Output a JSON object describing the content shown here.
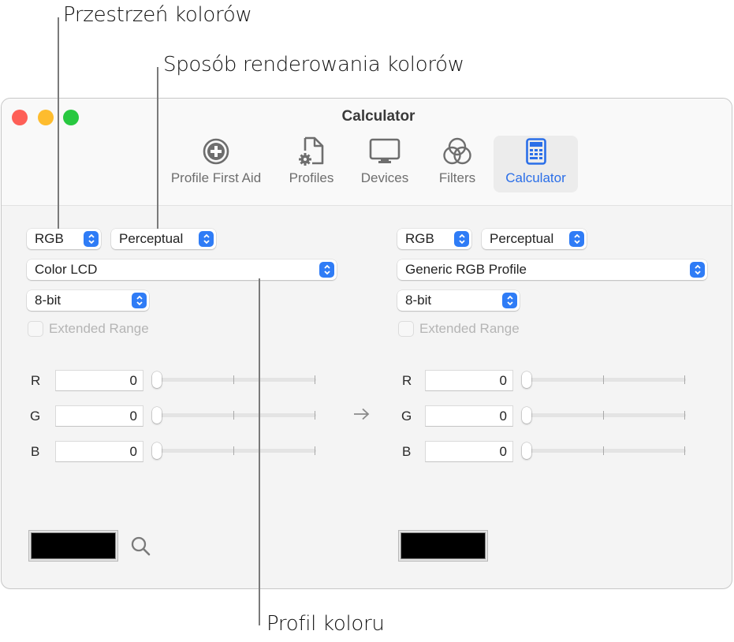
{
  "callouts": {
    "color_space": "Przestrzeń kolorów",
    "rendering_intent": "Sposób renderowania kolorów",
    "color_profile": "Profil koloru"
  },
  "window": {
    "title": "Calculator",
    "tabs": [
      {
        "label": "Profile First Aid",
        "icon": "first-aid-plus-icon",
        "active": false
      },
      {
        "label": "Profiles",
        "icon": "document-gear-icon",
        "active": false
      },
      {
        "label": "Devices",
        "icon": "monitor-icon",
        "active": false
      },
      {
        "label": "Filters",
        "icon": "overlapping-circles-icon",
        "active": false
      },
      {
        "label": "Calculator",
        "icon": "calculator-icon",
        "active": true
      }
    ]
  },
  "source": {
    "color_space": "RGB",
    "rendering_intent": "Perceptual",
    "profile": "Color LCD",
    "bit_depth": "8-bit",
    "extended_range_label": "Extended Range",
    "extended_range_checked": false,
    "channels": [
      {
        "label": "R",
        "value": "0",
        "slider_fraction": 0
      },
      {
        "label": "G",
        "value": "0",
        "slider_fraction": 0
      },
      {
        "label": "B",
        "value": "0",
        "slider_fraction": 0
      }
    ],
    "swatch_color": "#000000"
  },
  "destination": {
    "color_space": "RGB",
    "rendering_intent": "Perceptual",
    "profile": "Generic RGB Profile",
    "bit_depth": "8-bit",
    "extended_range_label": "Extended Range",
    "extended_range_checked": false,
    "channels": [
      {
        "label": "R",
        "value": "0",
        "slider_fraction": 0
      },
      {
        "label": "G",
        "value": "0",
        "slider_fraction": 0
      },
      {
        "label": "B",
        "value": "0",
        "slider_fraction": 0
      }
    ],
    "swatch_color": "#000000"
  },
  "colors": {
    "accent": "#2f7cf6",
    "active_tab_text": "#2a6ee8"
  }
}
